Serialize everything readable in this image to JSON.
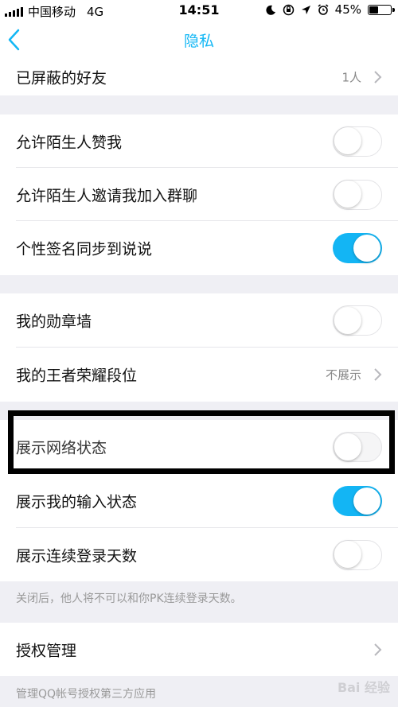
{
  "status_bar": {
    "carrier": "中国移动",
    "network": "4G",
    "time": "14:51",
    "battery_percent": "45%",
    "battery_level": 0.45
  },
  "nav": {
    "title": "隐私",
    "back_icon": "chevron-left-icon"
  },
  "rows": {
    "blocked_friends": {
      "label": "已屏蔽的好友",
      "value": "1人"
    },
    "stranger_likes": {
      "label": "允许陌生人赞我",
      "on": false
    },
    "stranger_group_invite": {
      "label": "允许陌生人邀请我加入群聊",
      "on": false
    },
    "signature_sync": {
      "label": "个性签名同步到说说",
      "on": true
    },
    "medal_wall": {
      "label": "我的勋章墙",
      "on": false
    },
    "honor_of_kings_rank": {
      "label": "我的王者荣耀段位",
      "value": "不展示"
    },
    "show_network_status": {
      "label": "展示网络状态",
      "on": false
    },
    "show_typing_status": {
      "label": "展示我的输入状态",
      "on": true
    },
    "show_login_streak": {
      "label": "展示连续登录天数",
      "on": false
    },
    "authorization": {
      "label": "授权管理"
    }
  },
  "footnotes": {
    "login_streak_note": "关闭后，他人将不可以和你PK连续登录天数。",
    "authorization_note": "管理QQ帐号授权第三方应用"
  },
  "watermark": "Bai 经验",
  "colors": {
    "accent": "#12b7f5",
    "toggle_on": "#13b5f4",
    "background": "#efeff4"
  }
}
